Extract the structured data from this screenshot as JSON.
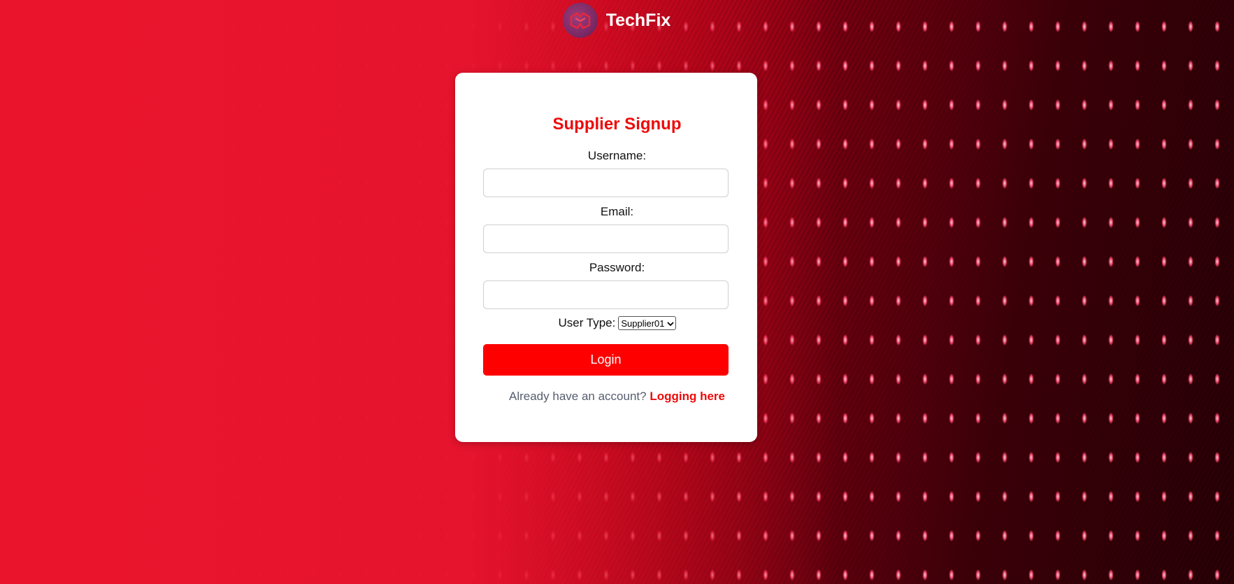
{
  "header": {
    "brand_name": "TechFix",
    "logo_icon": "techfix-logo-icon"
  },
  "form": {
    "title": "Supplier Signup",
    "username_label": "Username:",
    "username_value": "",
    "email_label": "Email:",
    "email_value": "",
    "password_label": "Password:",
    "password_value": "",
    "user_type_label": "User Type:",
    "user_type_selected": "Supplier01",
    "submit_label": "Login",
    "footer_text": "Already have an account?",
    "footer_link": "Logging here"
  },
  "colors": {
    "accent": "#ee0a0a",
    "button": "#ff0000",
    "background": "#c8001a"
  }
}
